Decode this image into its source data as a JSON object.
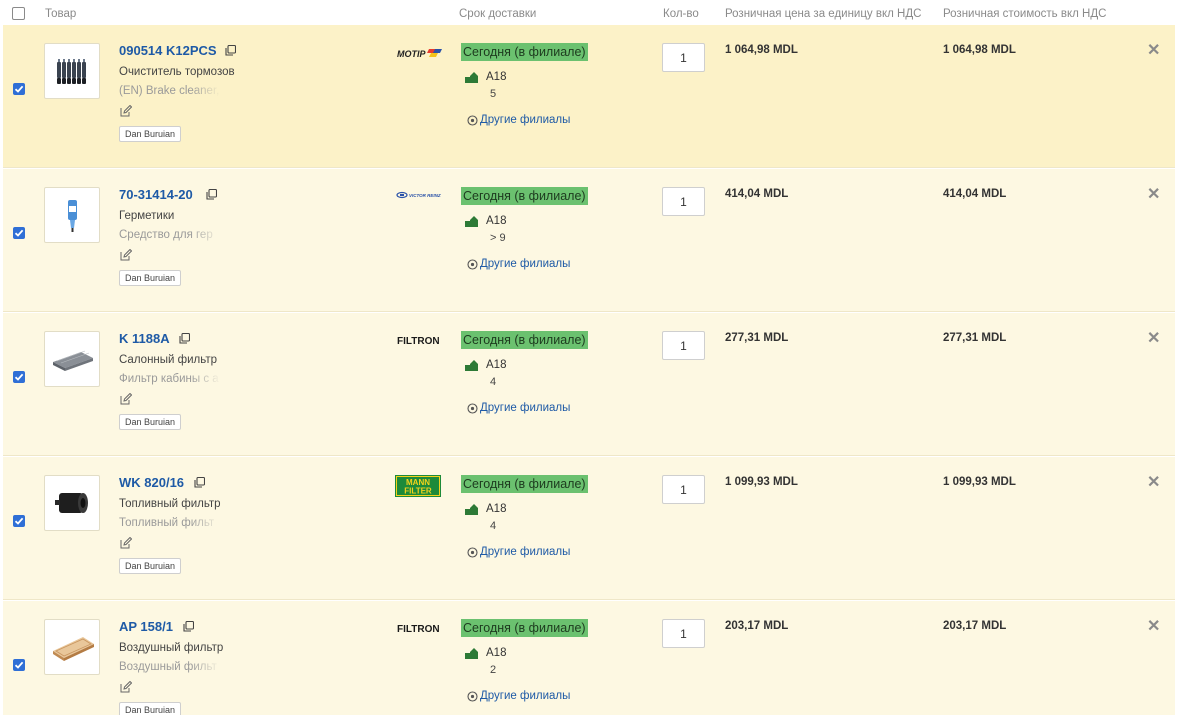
{
  "header": {
    "product": "Товар",
    "delivery": "Срок доставки",
    "qty": "Кол-во",
    "unit_price": "Розничная цена за единицу вкл НДС",
    "total_price": "Розничная стоимость вкл НДС"
  },
  "rows": [
    {
      "checked": true,
      "code": "090514 K12PCS",
      "name": "Очиститель тормозов",
      "desc": "(EN) Brake cleaner, l",
      "user": "Dan Buruian",
      "brand": "MOTIP",
      "delivery": "Сегодня (в филиале)",
      "stock_code": "A18",
      "stock_qty": "5",
      "branches": "Другие филиалы",
      "qty": "1",
      "unit_price": "1 064,98 MDL",
      "total_price": "1 064,98 MDL",
      "thumb_icon": "spray-cans-icon"
    },
    {
      "checked": true,
      "code": "70-31414-20",
      "name": "Герметики",
      "desc": "Средство для гер",
      "user": "Dan Buruian",
      "brand": "VICTOR REINZ",
      "delivery": "Сегодня (в филиале)",
      "stock_code": "A18",
      "stock_qty": "> 9",
      "branches": "Другие филиалы",
      "qty": "1",
      "unit_price": "414,04 MDL",
      "total_price": "414,04 MDL",
      "thumb_icon": "sealant-tube-icon"
    },
    {
      "checked": true,
      "code": "K 1188A",
      "name": "Салонный фильтр",
      "desc": "Фильтр кабины с а",
      "user": "Dan Buruian",
      "brand": "FILTRON",
      "delivery": "Сегодня (в филиале)",
      "stock_code": "A18",
      "stock_qty": "4",
      "branches": "Другие филиалы",
      "qty": "1",
      "unit_price": "277,31 MDL",
      "total_price": "277,31 MDL",
      "thumb_icon": "cabin-filter-icon"
    },
    {
      "checked": true,
      "code": "WK 820/16",
      "name": "Топливный фильтр",
      "desc": "Топливный фильт",
      "user": "Dan Buruian",
      "brand": "MANN FILTER",
      "delivery": "Сегодня (в филиале)",
      "stock_code": "A18",
      "stock_qty": "4",
      "branches": "Другие филиалы",
      "qty": "1",
      "unit_price": "1 099,93 MDL",
      "total_price": "1 099,93 MDL",
      "thumb_icon": "fuel-filter-icon"
    },
    {
      "checked": true,
      "code": "AP 158/1",
      "name": "Воздушный фильтр",
      "desc": "Воздушный фильт",
      "user": "Dan Buruian",
      "brand": "FILTRON",
      "delivery": "Сегодня (в филиале)",
      "stock_code": "A18",
      "stock_qty": "2",
      "branches": "Другие филиалы",
      "qty": "1",
      "unit_price": "203,17 MDL",
      "total_price": "203,17 MDL",
      "thumb_icon": "air-filter-icon"
    }
  ],
  "colors": {
    "link": "#1e5aa6",
    "delivery_bg": "#6bc16f",
    "row_bg": "#fdf8e2",
    "row_highlight_bg": "#fcf2c8",
    "checkbox": "#2f6fd6"
  }
}
